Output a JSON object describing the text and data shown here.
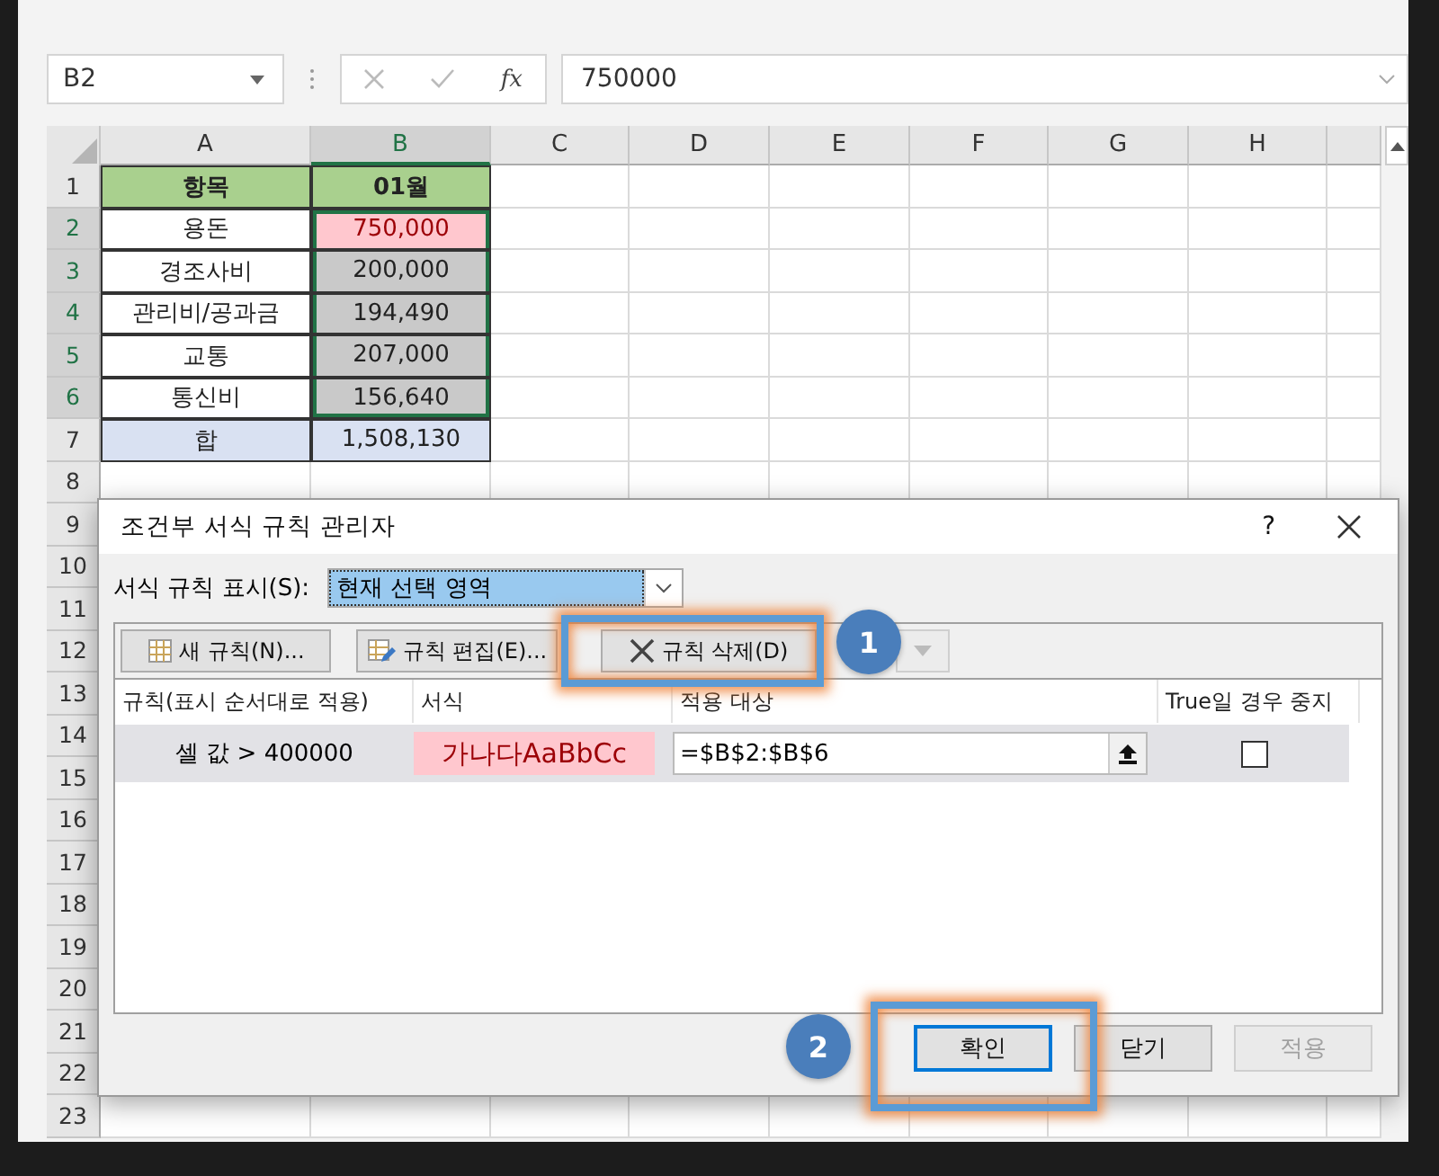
{
  "formula_bar": {
    "name_box": "B2",
    "fx": "fx",
    "formula": "750000"
  },
  "columns": [
    {
      "label": "A",
      "selected": false
    },
    {
      "label": "B",
      "selected": true
    },
    {
      "label": "C",
      "selected": false
    },
    {
      "label": "D",
      "selected": false
    },
    {
      "label": "E",
      "selected": false
    },
    {
      "label": "F",
      "selected": false
    },
    {
      "label": "G",
      "selected": false
    },
    {
      "label": "H",
      "selected": false
    }
  ],
  "rows": [
    {
      "number": "1",
      "selected": false,
      "cells": [
        {
          "text": "항목",
          "kind": "header"
        },
        {
          "text": "01월",
          "kind": "header"
        }
      ]
    },
    {
      "number": "2",
      "selected": true,
      "cells": [
        {
          "text": "용돈",
          "kind": "plain"
        },
        {
          "text": "750,000",
          "kind": "highlight"
        }
      ]
    },
    {
      "number": "3",
      "selected": true,
      "cells": [
        {
          "text": "경조사비",
          "kind": "plain"
        },
        {
          "text": "200,000",
          "kind": "shaded"
        }
      ]
    },
    {
      "number": "4",
      "selected": true,
      "cells": [
        {
          "text": "관리비/공과금",
          "kind": "plain"
        },
        {
          "text": "194,490",
          "kind": "shaded"
        }
      ]
    },
    {
      "number": "5",
      "selected": true,
      "cells": [
        {
          "text": "교통",
          "kind": "plain"
        },
        {
          "text": "207,000",
          "kind": "shaded"
        }
      ]
    },
    {
      "number": "6",
      "selected": true,
      "cells": [
        {
          "text": "통신비",
          "kind": "plain"
        },
        {
          "text": "156,640",
          "kind": "shaded"
        }
      ]
    },
    {
      "number": "7",
      "selected": false,
      "cells": [
        {
          "text": "합",
          "kind": "total"
        },
        {
          "text": "1,508,130",
          "kind": "total"
        }
      ]
    },
    {
      "number": "8",
      "selected": false
    },
    {
      "number": "9",
      "selected": false
    },
    {
      "number": "10",
      "selected": false
    },
    {
      "number": "11",
      "selected": false
    },
    {
      "number": "12",
      "selected": false
    },
    {
      "number": "13",
      "selected": false
    },
    {
      "number": "14",
      "selected": false
    },
    {
      "number": "15",
      "selected": false
    },
    {
      "number": "16",
      "selected": false
    },
    {
      "number": "17",
      "selected": false
    },
    {
      "number": "18",
      "selected": false
    },
    {
      "number": "19",
      "selected": false
    },
    {
      "number": "20",
      "selected": false
    },
    {
      "number": "21",
      "selected": false
    },
    {
      "number": "22",
      "selected": false
    },
    {
      "number": "23",
      "selected": false
    }
  ],
  "dialog": {
    "title": "조건부 서식 규칙 관리자",
    "help": "?",
    "show_label": "서식 규칙 표시(S):",
    "show_value": "현재 선택 영역",
    "toolbar": [
      {
        "label": "새 규칙(N)...",
        "kind": "new",
        "disabled": false
      },
      {
        "label": "규칙 편집(E)...",
        "kind": "edit",
        "disabled": false
      },
      {
        "label": "규칙 삭제(D)",
        "kind": "delete",
        "disabled": false
      },
      {
        "kind": "down",
        "disabled": true
      }
    ],
    "table_columns": [
      "규칙(표시 순서대로 적용)",
      "서식",
      "적용 대상",
      "True일 경우 중지"
    ],
    "rules": [
      {
        "rule": "셀 값 > 400000",
        "preview": "가나다AaBbCc",
        "applies_to": "=$B$2:$B$6",
        "stop_if_true": false,
        "selected": true
      }
    ],
    "buttons": [
      {
        "label": "확인",
        "default": true,
        "disabled": false
      },
      {
        "label": "닫기",
        "default": false,
        "disabled": false
      },
      {
        "label": "적용",
        "default": false,
        "disabled": true
      }
    ]
  },
  "annotations": [
    {
      "number": "1"
    },
    {
      "number": "2"
    }
  ]
}
